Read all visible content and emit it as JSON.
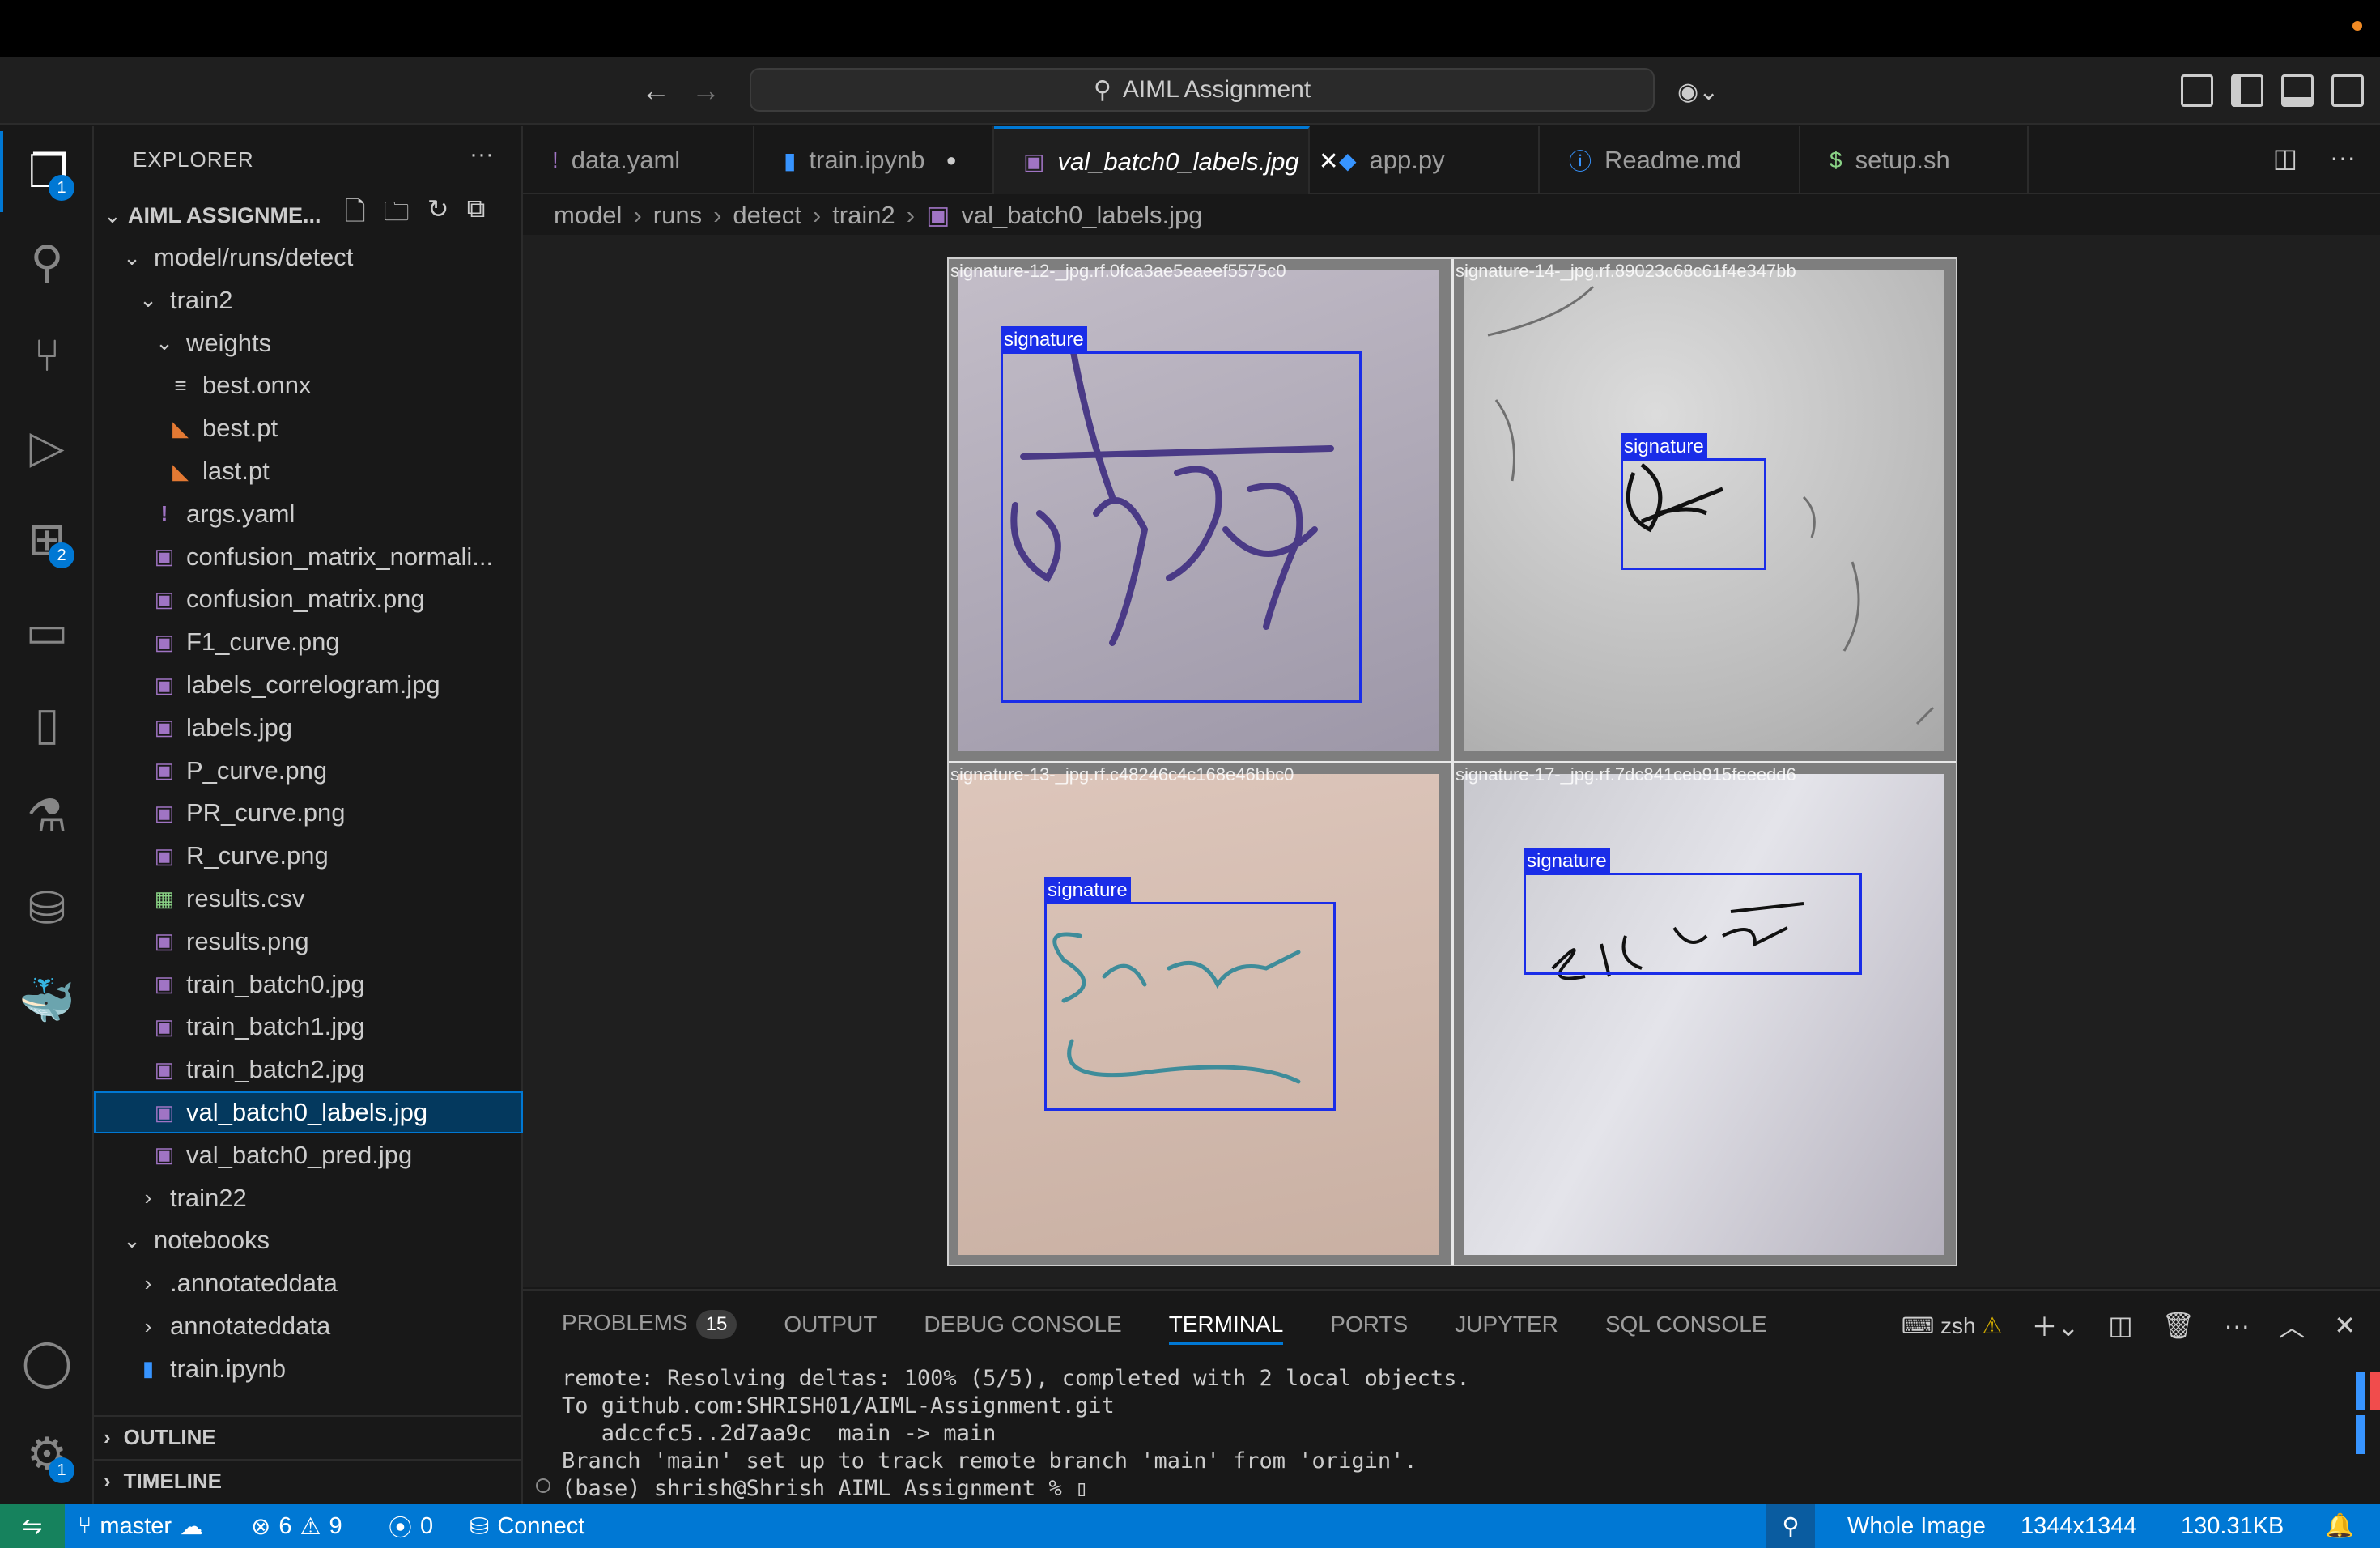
{
  "window": {
    "title": "AIML Assignment"
  },
  "activity_bar": {
    "explorer_badge": "1",
    "extensions_badge": "2",
    "settings_badge": "1"
  },
  "sidebar": {
    "title": "EXPLORER",
    "more": "···",
    "root": "AIML ASSIGNME...",
    "tree": [
      {
        "label": "model/runs/detect",
        "type": "folder-open",
        "indent": 0
      },
      {
        "label": "train2",
        "type": "folder-open",
        "indent": 1
      },
      {
        "label": "weights",
        "type": "folder-open",
        "indent": 2
      },
      {
        "label": "best.onnx",
        "type": "lines",
        "indent": 3
      },
      {
        "label": "best.pt",
        "type": "rss",
        "indent": 3
      },
      {
        "label": "last.pt",
        "type": "rss",
        "indent": 3
      },
      {
        "label": "args.yaml",
        "type": "excl",
        "indent": 2
      },
      {
        "label": "confusion_matrix_normali...",
        "type": "img",
        "indent": 2
      },
      {
        "label": "confusion_matrix.png",
        "type": "img",
        "indent": 2
      },
      {
        "label": "F1_curve.png",
        "type": "img",
        "indent": 2
      },
      {
        "label": "labels_correlogram.jpg",
        "type": "img",
        "indent": 2
      },
      {
        "label": "labels.jpg",
        "type": "img",
        "indent": 2
      },
      {
        "label": "P_curve.png",
        "type": "img",
        "indent": 2
      },
      {
        "label": "PR_curve.png",
        "type": "img",
        "indent": 2
      },
      {
        "label": "R_curve.png",
        "type": "img",
        "indent": 2
      },
      {
        "label": "results.csv",
        "type": "csv",
        "indent": 2
      },
      {
        "label": "results.png",
        "type": "img",
        "indent": 2
      },
      {
        "label": "train_batch0.jpg",
        "type": "img",
        "indent": 2
      },
      {
        "label": "train_batch1.jpg",
        "type": "img",
        "indent": 2
      },
      {
        "label": "train_batch2.jpg",
        "type": "img",
        "indent": 2
      },
      {
        "label": "val_batch0_labels.jpg",
        "type": "img",
        "indent": 2,
        "selected": true
      },
      {
        "label": "val_batch0_pred.jpg",
        "type": "img",
        "indent": 2
      },
      {
        "label": "train22",
        "type": "folder-closed",
        "indent": 1
      },
      {
        "label": "notebooks",
        "type": "folder-open",
        "indent": 0
      },
      {
        "label": ".annotateddata",
        "type": "folder-closed",
        "indent": 1
      },
      {
        "label": "annotateddata",
        "type": "folder-closed",
        "indent": 1
      },
      {
        "label": "train.ipynb",
        "type": "nb",
        "indent": 1
      }
    ],
    "outline": "OUTLINE",
    "timeline": "TIMELINE"
  },
  "tabs": [
    {
      "label": "data.yaml",
      "icon": "!",
      "color": "#a074c4"
    },
    {
      "label": "train.ipynb",
      "icon": "▮",
      "color": "#3794ff",
      "dirty": true
    },
    {
      "label": "val_batch0_labels.jpg",
      "icon": "▣",
      "color": "#a074c4",
      "active": true
    },
    {
      "label": "app.py",
      "icon": "◆",
      "color": "#3794ff"
    },
    {
      "label": "Readme.md",
      "icon": "ⓘ",
      "color": "#3794ff"
    },
    {
      "label": "setup.sh",
      "icon": "$",
      "color": "#89d185"
    }
  ],
  "breadcrumb": [
    "model",
    "runs",
    "detect",
    "train2",
    "val_batch0_labels.jpg"
  ],
  "image": {
    "cells": [
      {
        "caption": "signature-12-_jpg.rf.0fca3ae5eaeef5575c0",
        "label": "signature"
      },
      {
        "caption": "signature-14-_jpg.rf.89023c68c61f4e347bb",
        "label": "signature"
      },
      {
        "caption": "signature-13-_jpg.rf.c48246c4c168e46bbc0",
        "label": "signature"
      },
      {
        "caption": "signature-17-_jpg.rf.7dc841ceb915feeedd6",
        "label": "signature"
      }
    ]
  },
  "panel": {
    "tabs": [
      "PROBLEMS",
      "OUTPUT",
      "DEBUG CONSOLE",
      "TERMINAL",
      "PORTS",
      "JUPYTER",
      "SQL CONSOLE"
    ],
    "problems_count": "15",
    "active_tab": "TERMINAL",
    "shell": "zsh",
    "terminal_lines": [
      "remote: Resolving deltas: 100% (5/5), completed with 2 local objects.",
      "To github.com:SHRISH01/AIML-Assignment.git",
      "   adccfc5..2d7aa9c  main -> main",
      "Branch 'main' set up to track remote branch 'main' from 'origin'.",
      "(base) shrish@Shrish AIML Assignment % "
    ]
  },
  "status": {
    "branch": "master",
    "errors": "6",
    "warnings": "9",
    "ports": "0",
    "connect": "Connect",
    "zoom": "Whole Image",
    "dimensions": "1344x1344",
    "filesize": "130.31KB"
  }
}
